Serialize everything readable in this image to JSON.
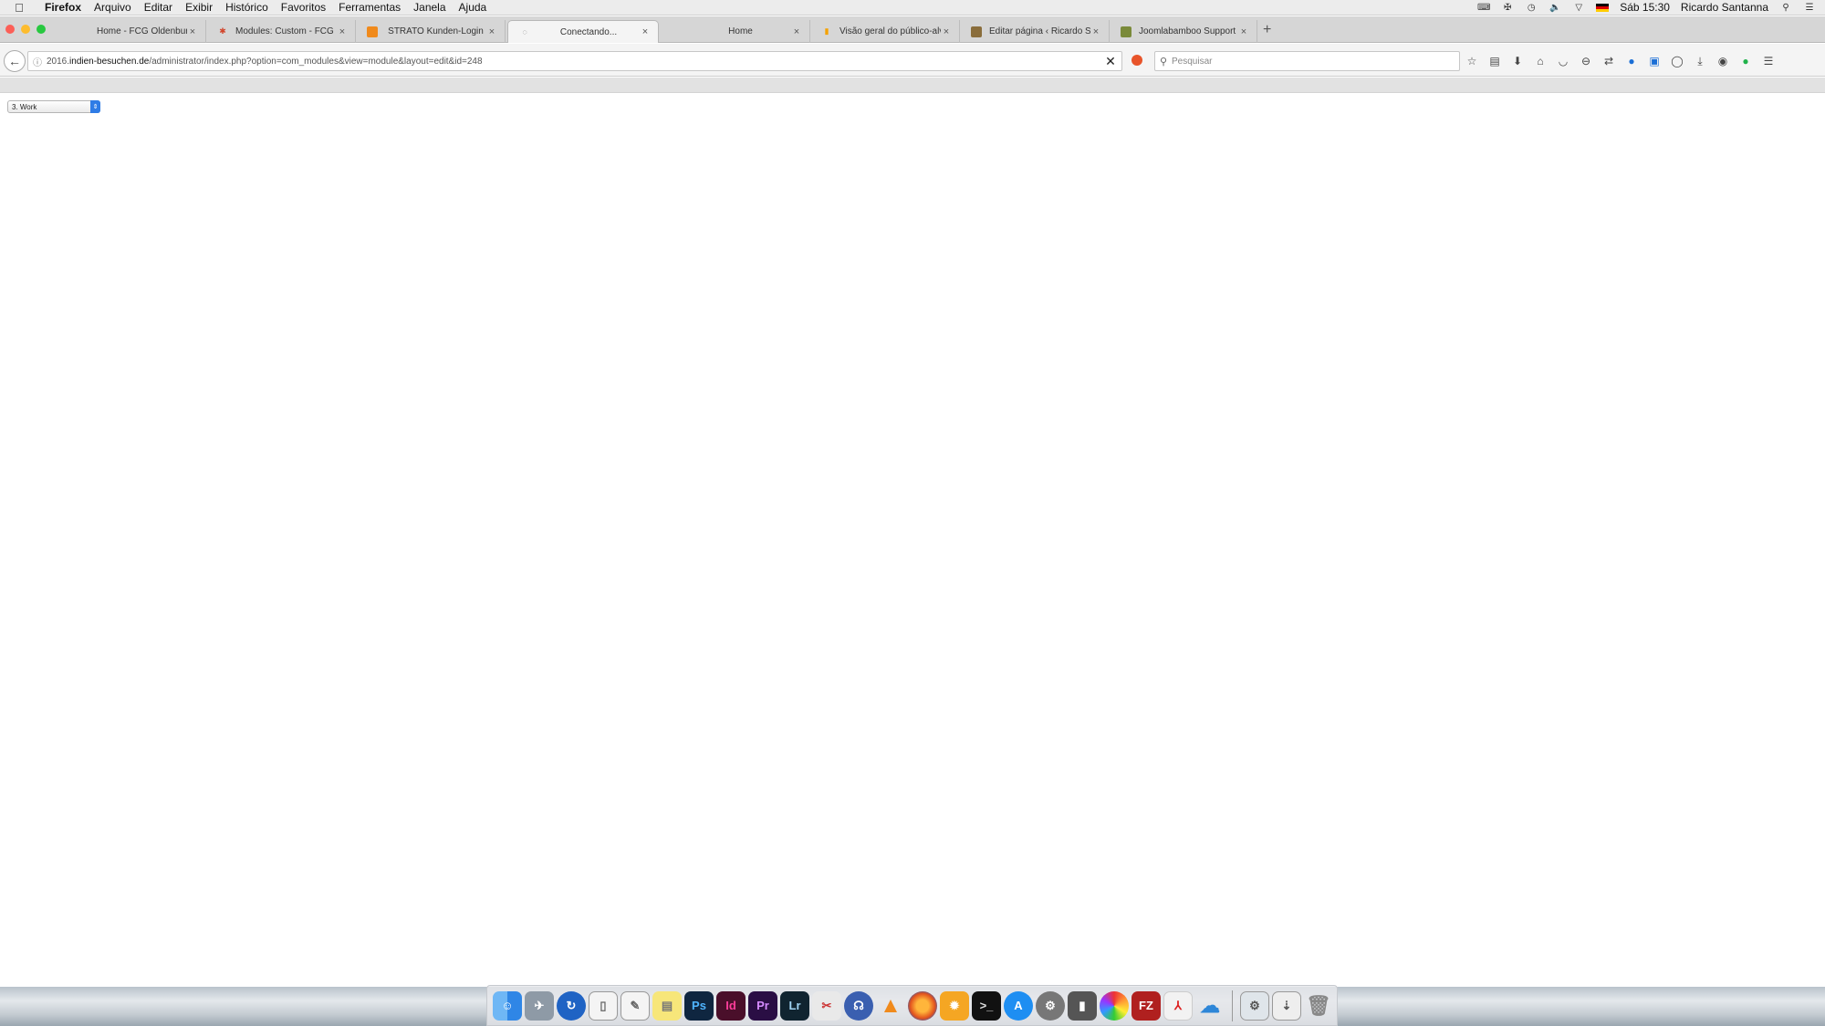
{
  "menubar": {
    "app_name": "Firefox",
    "items": [
      "Arquivo",
      "Editar",
      "Exibir",
      "Histórico",
      "Favoritos",
      "Ferramentas",
      "Janela",
      "Ajuda"
    ],
    "clock": "Sáb 15:30",
    "user": "Ricardo Santanna"
  },
  "tabs": [
    {
      "title": "Home - FCG Oldenburg"
    },
    {
      "title": "Modules: Custom - FCG Ol..."
    },
    {
      "title": "STRATO Kunden-Login"
    },
    {
      "title": "Conectando..."
    },
    {
      "title": "Home"
    },
    {
      "title": "Visão geral do público-alvo..."
    },
    {
      "title": "Editar página ‹ Ricardo San..."
    },
    {
      "title": "Joomlabamboo Support Fo..."
    }
  ],
  "navbar": {
    "url_prefix": "2016.",
    "url_domain": "indien-besuchen.de",
    "url_path": "/administrator/index.php?option=com_modules&view=module&layout=edit&id=248",
    "search_placeholder": "Pesquisar"
  },
  "content": {
    "select_value": "3. Work"
  }
}
